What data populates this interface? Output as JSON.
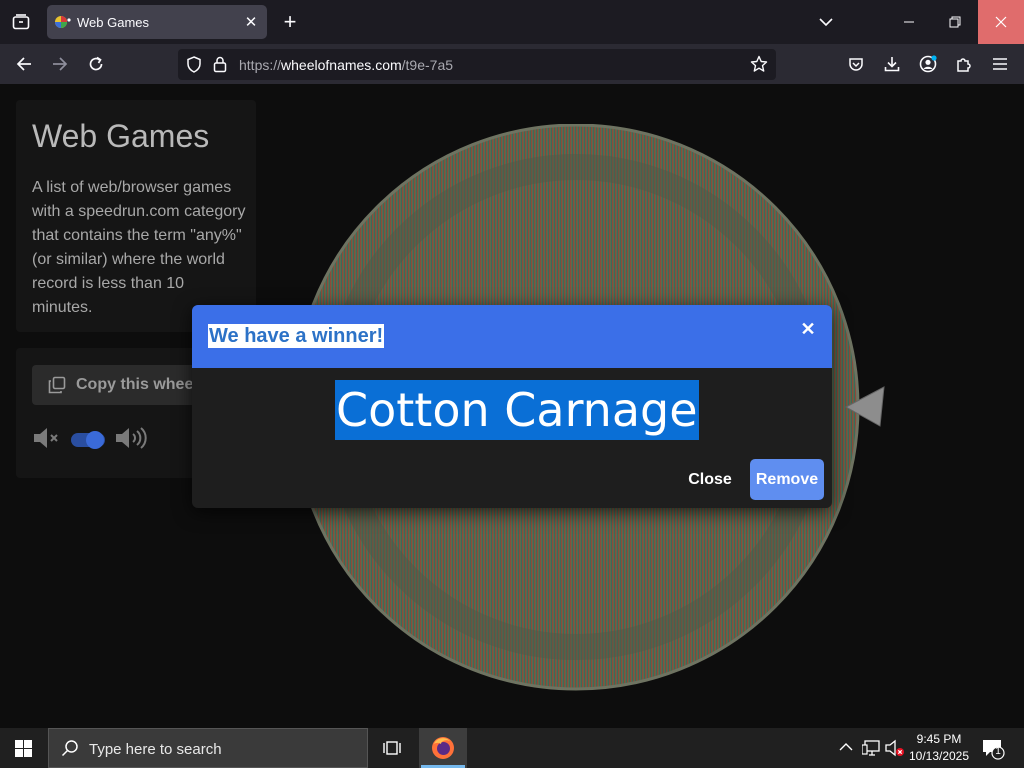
{
  "browser": {
    "tab_title": "Web Games",
    "url_prefix": "https://",
    "url_domain": "wheelofnames.com",
    "url_path": "/t9e-7a5"
  },
  "page": {
    "title": "Web Games",
    "description": "A list of web/browser games with a speedrun.com category that contains the term \"any%\" (or similar) where the world record is less than 10 minutes.",
    "copy_button_label": "Copy this wheel",
    "sound_enabled": true
  },
  "dialog": {
    "title": "We have a winner!",
    "winner": "Cotton Carnage",
    "close_label": "Close",
    "remove_label": "Remove"
  },
  "taskbar": {
    "search_placeholder": "Type here to search",
    "time": "9:45 PM",
    "date": "10/13/2025",
    "notification_count": "1"
  },
  "colors": {
    "dialog_header": "#3b6fe8",
    "remove_button": "#5f8ef0",
    "selection": "#0a6fd6"
  }
}
